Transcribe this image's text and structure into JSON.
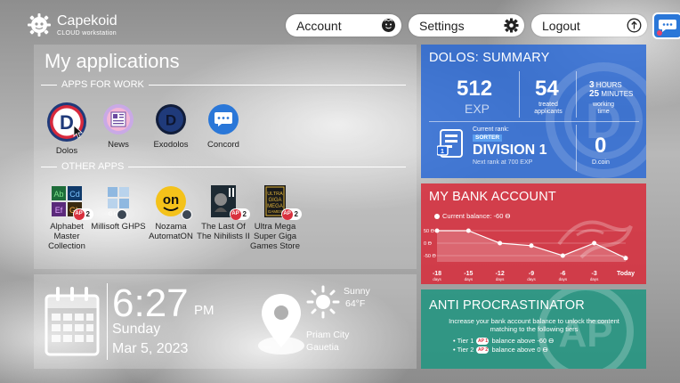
{
  "brand": {
    "name": "Capekoid",
    "subtitle": "CLOUD workstation"
  },
  "header": {
    "account_label": "Account",
    "settings_label": "Settings",
    "logout_label": "Logout"
  },
  "apps": {
    "title": "My applications",
    "work_section": "APPS FOR WORK",
    "other_section": "OTHER APPS",
    "work_apps": [
      {
        "label": "Dolos",
        "icon": "dolos-icon"
      },
      {
        "label": "News",
        "icon": "news-icon"
      },
      {
        "label": "Exodolos",
        "icon": "exodolos-icon"
      },
      {
        "label": "Concord",
        "icon": "concord-icon"
      }
    ],
    "other_apps": [
      {
        "label": "Alphabet Master Collection",
        "icon": "alphabet-icon",
        "badge_count": "2"
      },
      {
        "label": "Millisoft GHPS",
        "icon": "millisoft-icon"
      },
      {
        "label": "Nozama AutomatON",
        "icon": "nozama-icon"
      },
      {
        "label": "The Last Of The Nihilists II",
        "icon": "nihilists-icon",
        "badge_count": "2"
      },
      {
        "label": "Ultra Mega Super Giga Games Store",
        "icon": "games-store-icon",
        "badge_count": "2"
      }
    ],
    "badge_tag": "AP"
  },
  "clock": {
    "time": "6:27",
    "ampm": "PM",
    "day": "Sunday",
    "date": "Mar 5, 2023"
  },
  "weather": {
    "condition": "Sunny",
    "temperature": "64°F"
  },
  "location": {
    "city": "Priam City",
    "region": "Gauetia"
  },
  "dolos": {
    "title": "DOLOS: SUMMARY",
    "exp_value": "512",
    "exp_label": "EXP",
    "treated_value": "54",
    "treated_label": "treated applicants",
    "hours_value": "3",
    "hours_unit": "HOURS",
    "minutes_value": "25",
    "minutes_unit": "MINUTES",
    "working_label": "working time",
    "rank_label": "Current rank:",
    "rank_tag": "SORTER",
    "division": "DIVISION 1",
    "next_rank": "Next rank at 700 EXP",
    "dcoin_value": "0",
    "dcoin_label": "D.coin"
  },
  "bank": {
    "title": "MY BANK ACCOUNT",
    "balance_label": "Current balance: -60 ϴ",
    "chart_data": {
      "type": "line",
      "x": [
        "-18",
        "-15",
        "-12",
        "-9",
        "-6",
        "-3",
        "Today"
      ],
      "x_unit": "days",
      "values": [
        50,
        50,
        0,
        -10,
        -50,
        0,
        -60
      ],
      "y_ticks": [
        "50 ϴ",
        "0 ϴ",
        "-50 ϴ"
      ],
      "ylim": [
        -75,
        75
      ]
    }
  },
  "anti": {
    "title": "ANTI PROCRASTINATOR",
    "description": "Increase your bank account balance to unlock the content matching to the following tiers",
    "tier1_label": "• Tier 1",
    "tier1_text": "balance above -60 ϴ",
    "tier2_label": "• Tier 2",
    "tier2_text": "balance above 0 ϴ"
  }
}
